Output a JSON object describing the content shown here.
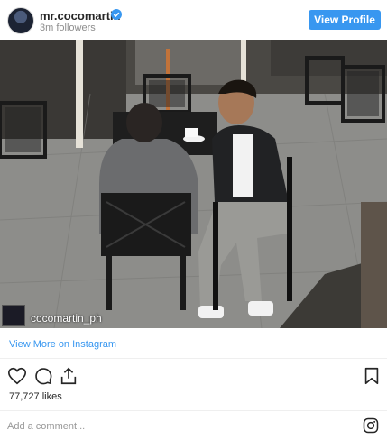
{
  "header": {
    "username": "mr.cocomartin",
    "followers": "3m followers",
    "view_profile_label": "View Profile"
  },
  "photo": {
    "caption_username": "cocomartin_ph"
  },
  "view_more": {
    "label": "View More on Instagram"
  },
  "stats": {
    "likes": "77,727 likes"
  },
  "comment": {
    "placeholder": "Add a comment..."
  },
  "colors": {
    "accent": "#3897f0",
    "text": "#262626",
    "muted": "#8e8e8e"
  },
  "icons": [
    "heart-icon",
    "comment-icon",
    "share-icon",
    "bookmark-icon",
    "instagram-icon",
    "verified-icon"
  ]
}
